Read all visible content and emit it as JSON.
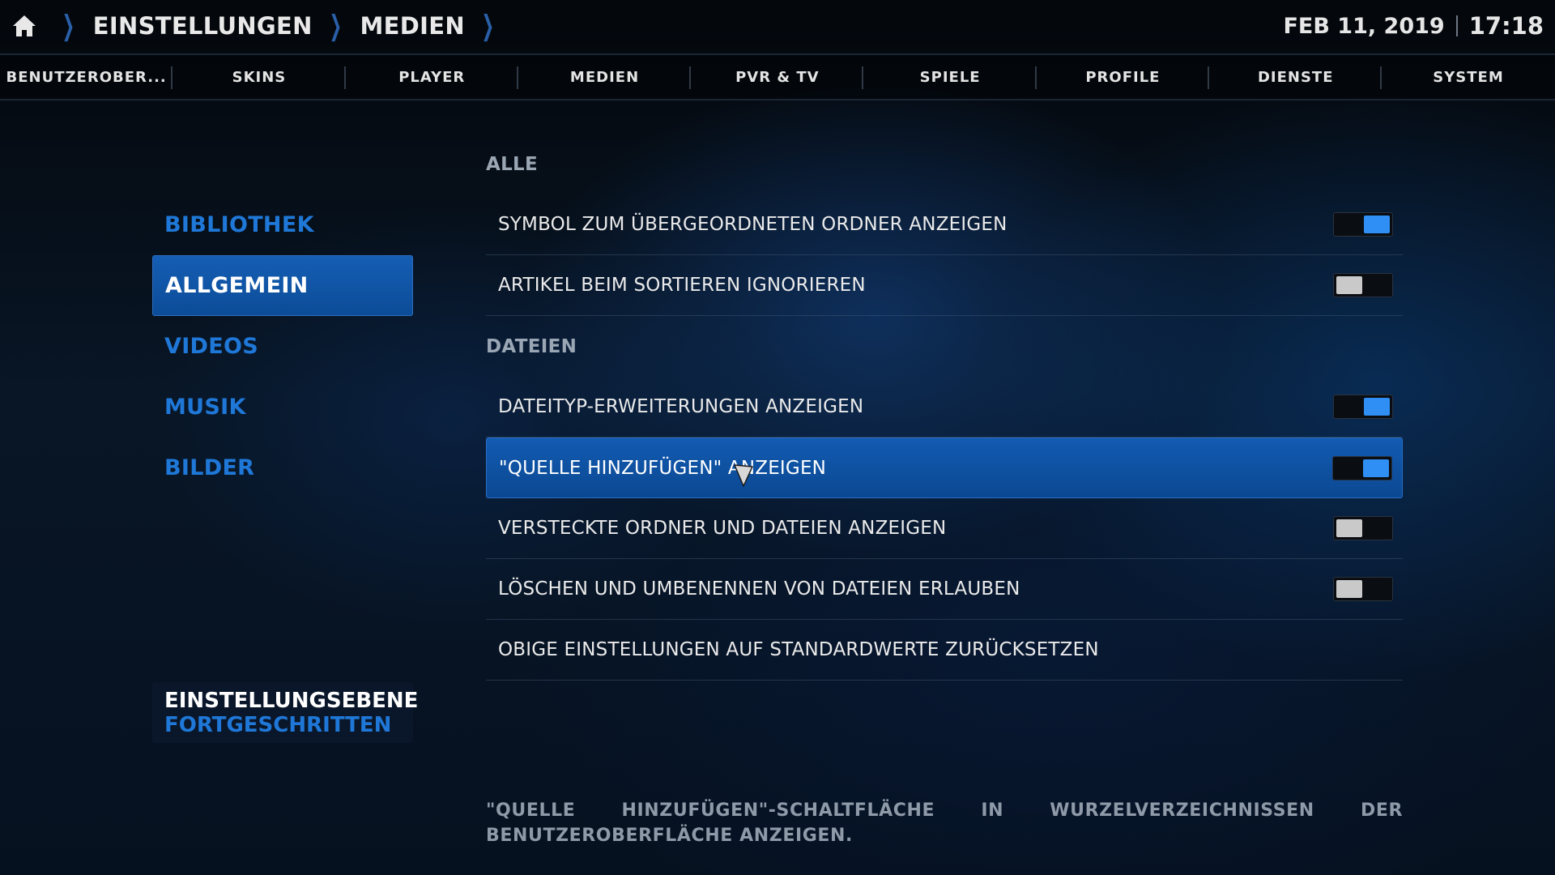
{
  "header": {
    "breadcrumbs": [
      "EINSTELLUNGEN",
      "MEDIEN"
    ],
    "date": "FEB 11, 2019",
    "time": "17:18"
  },
  "tabs": [
    "BENUTZEROBER...",
    "SKINS",
    "PLAYER",
    "MEDIEN",
    "PVR & TV",
    "SPIELE",
    "PROFILE",
    "DIENSTE",
    "SYSTEM"
  ],
  "categories": [
    {
      "label": "BIBLIOTHEK",
      "active": false
    },
    {
      "label": "ALLGEMEIN",
      "active": true
    },
    {
      "label": "VIDEOS",
      "active": false
    },
    {
      "label": "MUSIK",
      "active": false
    },
    {
      "label": "BILDER",
      "active": false
    }
  ],
  "settings_level": {
    "title": "EINSTELLUNGSEBENE",
    "value": "FORTGESCHRITTEN"
  },
  "groups": [
    {
      "heading": "ALLE",
      "items": [
        {
          "label": "SYMBOL ZUM ÜBERGEORDNETEN ORDNER ANZEIGEN",
          "toggle": "on"
        },
        {
          "label": "ARTIKEL BEIM SORTIEREN IGNORIEREN",
          "toggle": "off"
        }
      ]
    },
    {
      "heading": "DATEIEN",
      "items": [
        {
          "label": "DATEITYP-ERWEITERUNGEN ANZEIGEN",
          "toggle": "on"
        },
        {
          "label": "\"QUELLE HINZUFÜGEN\" ANZEIGEN",
          "toggle": "on",
          "focused": true
        },
        {
          "label": "VERSTECKTE ORDNER UND DATEIEN ANZEIGEN",
          "toggle": "off"
        },
        {
          "label": "LÖSCHEN UND UMBENENNEN VON DATEIEN ERLAUBEN",
          "toggle": "off"
        },
        {
          "label": "OBIGE EINSTELLUNGEN AUF STANDARDWERTE ZURÜCKSETZEN",
          "toggle": null
        }
      ]
    }
  ],
  "description": "\"QUELLE HINZUFÜGEN\"-SCHALTFLÄCHE IN WURZELVERZEICHNISSEN DER BENUTZEROBERFLÄCHE ANZEIGEN.",
  "colors": {
    "accent": "#1f78d8",
    "focus": "#125bb2",
    "toggle_on": "#2f8ff4",
    "toggle_off": "#c9c9c9"
  }
}
